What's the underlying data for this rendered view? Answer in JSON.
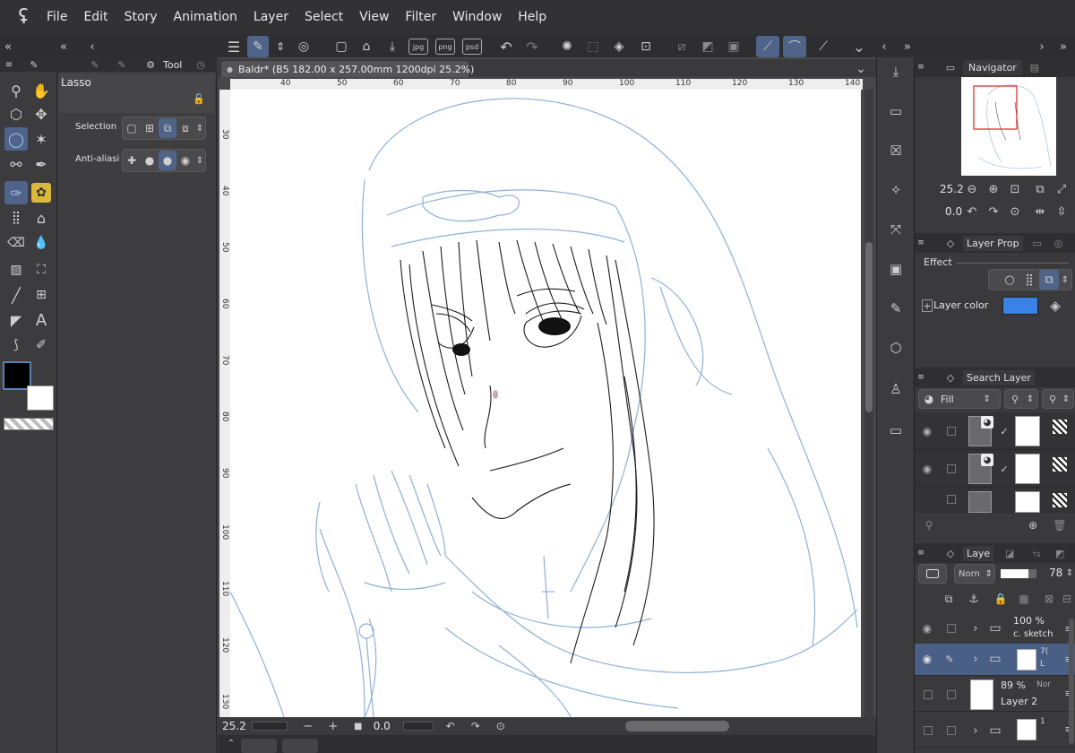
{
  "menu": {
    "items": [
      "File",
      "Edit",
      "Story",
      "Animation",
      "Layer",
      "Select",
      "View",
      "Filter",
      "Window",
      "Help"
    ]
  },
  "toolbar": {
    "file_tab": "Baldr* (B5 182.00 x 257.00mm 1200dpi 25.2%)",
    "format_buttons": [
      "jpg",
      "png",
      "psd"
    ]
  },
  "tool_palette": {
    "tool_tab_label": "Tool"
  },
  "tool_property": {
    "tool_name": "Lasso",
    "selection_mode_label": "Selection m",
    "anti_aliasing_label": "Anti-aliasing"
  },
  "canvas": {
    "ruler_top": [
      "40",
      "50",
      "60",
      "70",
      "80",
      "90",
      "100",
      "110",
      "120",
      "130",
      "140"
    ],
    "ruler_left": [
      "30",
      "40",
      "50",
      "60",
      "70",
      "80",
      "90",
      "100",
      "110",
      "120",
      "130"
    ],
    "zoom_value": "25.2",
    "rotation_value": "0.0"
  },
  "navigator": {
    "title": "Navigator",
    "zoom": "25.2",
    "rotation": "0.0"
  },
  "layer_property": {
    "title": "Layer Prop",
    "effect_label": "Effect",
    "layer_color_label": "Layer color",
    "layer_color": "#3b82e8"
  },
  "search_layer": {
    "title": "Search Layer",
    "fill_label": "Fill"
  },
  "layer_panel": {
    "title": "Laye",
    "blend_mode": "Norn",
    "opacity": "78",
    "layers": [
      {
        "percent": "100 %",
        "name": "c. sketch",
        "type": "folder"
      },
      {
        "percent": "7(",
        "name": "L",
        "type": "folder"
      },
      {
        "percent": "89 %",
        "mode": "Nor",
        "name": "Layer 2",
        "type": "raster"
      },
      {
        "percent": "1",
        "name": "",
        "type": "folder"
      }
    ]
  },
  "colors": {
    "main": "#000000",
    "sub": "#ffffff",
    "accent": "#4f6488",
    "sketch_blue": "#8fb0d6"
  }
}
